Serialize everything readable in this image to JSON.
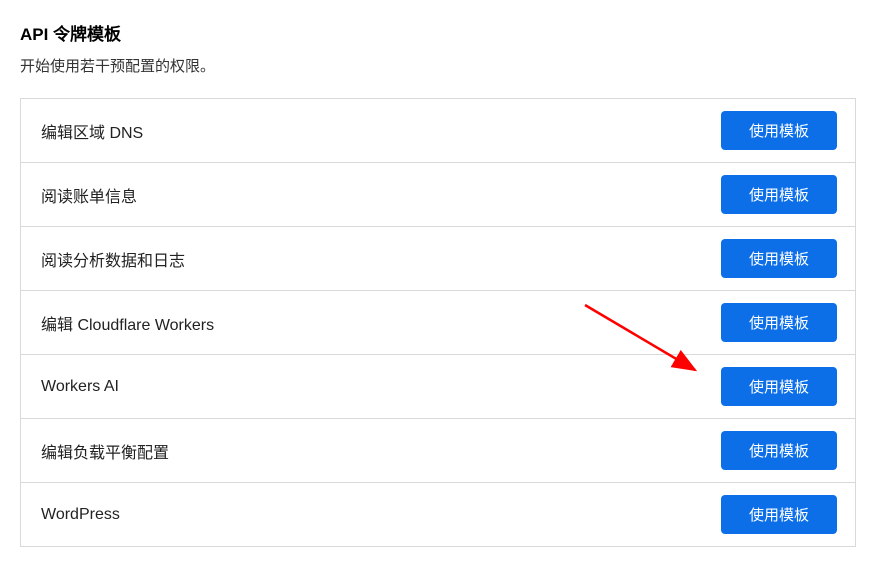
{
  "header": {
    "title": "API 令牌模板",
    "subtitle": "开始使用若干预配置的权限。"
  },
  "button_label": "使用模板",
  "templates": [
    {
      "name": "编辑区域 DNS"
    },
    {
      "name": "阅读账单信息"
    },
    {
      "name": "阅读分析数据和日志"
    },
    {
      "name": "编辑 Cloudflare Workers"
    },
    {
      "name": "Workers AI"
    },
    {
      "name": "编辑负载平衡配置"
    },
    {
      "name": "WordPress"
    }
  ],
  "annotation": {
    "highlighted_index": 4,
    "color": "#ff0000"
  }
}
